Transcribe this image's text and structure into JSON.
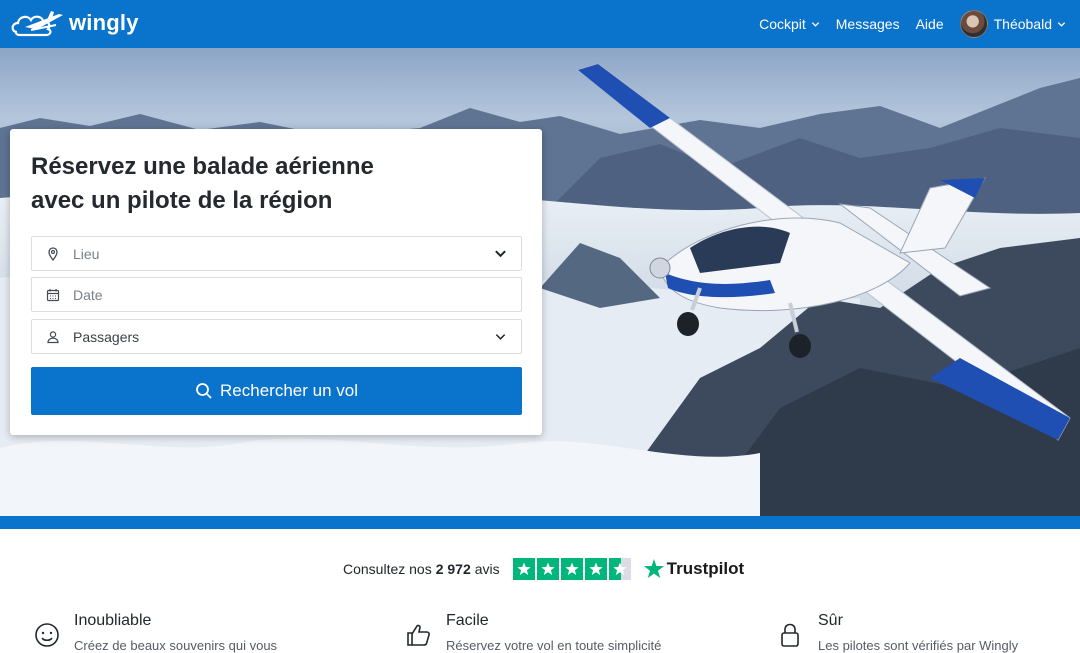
{
  "header": {
    "brand": "wingly",
    "nav": [
      {
        "label": "Cockpit",
        "has_dropdown": true
      },
      {
        "label": "Messages",
        "has_dropdown": false
      },
      {
        "label": "Aide",
        "has_dropdown": false
      }
    ],
    "user": {
      "name": "Théobald",
      "has_dropdown": true
    }
  },
  "search_card": {
    "title_line1": "Réservez une balade aérienne",
    "title_line2": "avec un pilote de la région",
    "fields": {
      "location": {
        "placeholder": "Lieu",
        "icon": "location-pin-icon"
      },
      "date": {
        "placeholder": "Date",
        "icon": "calendar-icon"
      },
      "passengers": {
        "placeholder": "Passagers",
        "icon": "person-icon"
      }
    },
    "search_button": "Rechercher un vol"
  },
  "trust": {
    "prefix": "Consultez nos",
    "count": "2 972",
    "suffix": "avis",
    "rating_stars": 4.5,
    "brand": "Trustpilot"
  },
  "features": [
    {
      "title": "Inoubliable",
      "description": "Créez de beaux souvenirs qui vous",
      "icon": "smiley-icon"
    },
    {
      "title": "Facile",
      "description": "Réservez votre vol en toute simplicité",
      "icon": "thumbs-up-icon"
    },
    {
      "title": "Sûr",
      "description": "Les pilotes sont vérifiés par Wingly",
      "icon": "lock-icon"
    }
  ],
  "colors": {
    "brand_blue": "#0a73cc",
    "trustpilot_green": "#00b67a"
  }
}
